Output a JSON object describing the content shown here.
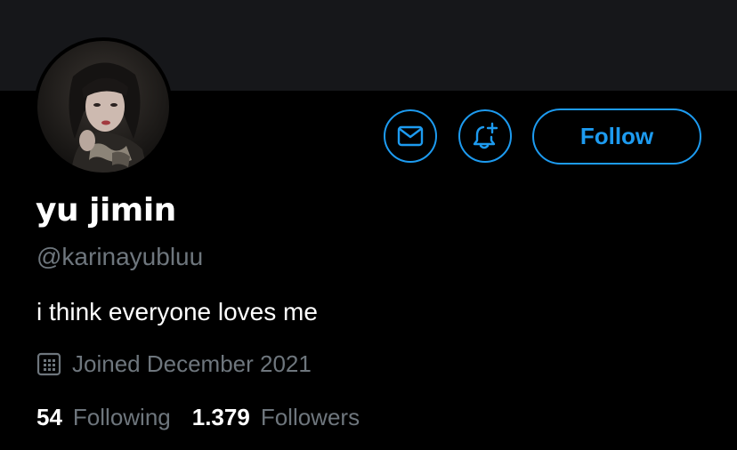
{
  "profile": {
    "display_name": "yu jimin",
    "handle": "@karinayubluu",
    "bio": "i think everyone loves me",
    "joined": "Joined December 2021"
  },
  "actions": {
    "message_icon": "envelope-icon",
    "notification_icon": "bell-plus-icon",
    "follow_label": "Follow"
  },
  "stats": {
    "following_count": "54",
    "following_label": "Following",
    "followers_count": "1.379",
    "followers_label": "Followers"
  },
  "colors": {
    "accent": "#1d9bf0",
    "background": "#000000",
    "banner": "#16171a",
    "secondary_text": "#6e767d"
  }
}
